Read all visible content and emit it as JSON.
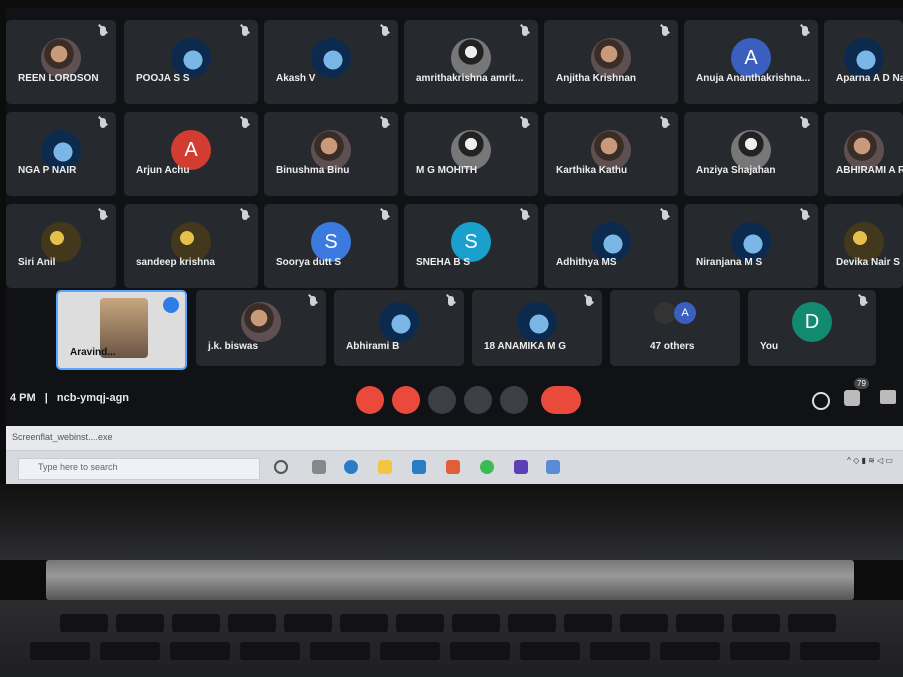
{
  "participants_row1": [
    {
      "name": "REEN LORDSON"
    },
    {
      "name": "POOJA S S"
    },
    {
      "name": "Akash V"
    },
    {
      "name": "amrithakrishna amrit..."
    },
    {
      "name": "Anjitha Krishnan"
    },
    {
      "name": "Anuja Ananthakrishna..."
    },
    {
      "name": "Aparna A D Nair"
    }
  ],
  "participants_row2": [
    {
      "name": "NGA P NAIR"
    },
    {
      "name": "Arjun Achu",
      "initial": "A"
    },
    {
      "name": "Binushma Binu"
    },
    {
      "name": "M G MOHITH"
    },
    {
      "name": "Karthika Kathu"
    },
    {
      "name": "Anziya Shajahan"
    },
    {
      "name": "ABHIRAMI A R"
    }
  ],
  "participants_row3": [
    {
      "name": "Siri Anil"
    },
    {
      "name": "sandeep krishna"
    },
    {
      "name": "Soorya dutt S",
      "initial": "S"
    },
    {
      "name": "SNEHA B S",
      "initial": "S"
    },
    {
      "name": "Adhithya MS"
    },
    {
      "name": "Niranjana M S"
    },
    {
      "name": "Devika Nair S B"
    }
  ],
  "participants_row4": [
    {
      "name": "Aravind..."
    },
    {
      "name": "j.k. biswas"
    },
    {
      "name": "Abhirami B"
    },
    {
      "name": "18 ANAMIKA M G"
    },
    {
      "name": "47 others",
      "initial": "A"
    },
    {
      "name": "You",
      "initial": "D"
    }
  ],
  "meeting": {
    "time": "4 PM",
    "code": "ncb-ymqj-agn",
    "people_count": "79"
  },
  "taskbar": {
    "download_file": "Screenflat_webinst....exe",
    "search_placeholder": "Type here to search"
  },
  "colors": {
    "avatar_blue": "#3b7be0",
    "avatar_red": "#d33d31",
    "avatar_cyan": "#19a0cc",
    "avatar_teal": "#128a6f"
  }
}
